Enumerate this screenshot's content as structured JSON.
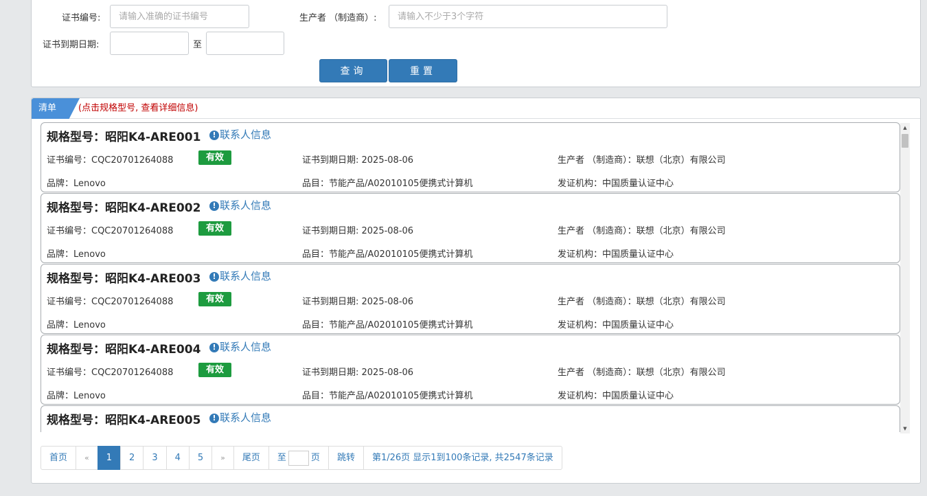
{
  "search": {
    "cert_no_label": "证书编号:",
    "cert_no_placeholder": "请输入准确的证书编号",
    "producer_label": "生产者 （制造商）:",
    "producer_placeholder": "请输入不少于3个字符",
    "expiry_label": "证书到期日期:",
    "range_sep": "至",
    "query_button": "查询",
    "reset_button": "重置"
  },
  "list": {
    "tab_label": "清单",
    "hint": "(点击规格型号, 查看详细信息)",
    "contact_label": "联系人信息",
    "records": [
      {
        "model": "规格型号：昭阳K4-ARE001",
        "cert_no": "证书编号：CQC20701264088",
        "status": "有效",
        "expiry": "证书到期日期: 2025-08-06",
        "producer": "生产者 （制造商）：联想（北京）有限公司",
        "brand": "品牌：Lenovo",
        "category": "品目：节能产品/A02010105便携式计算机",
        "issuer": "发证机构：中国质量认证中心"
      },
      {
        "model": "规格型号：昭阳K4-ARE002",
        "cert_no": "证书编号：CQC20701264088",
        "status": "有效",
        "expiry": "证书到期日期: 2025-08-06",
        "producer": "生产者 （制造商）：联想（北京）有限公司",
        "brand": "品牌：Lenovo",
        "category": "品目：节能产品/A02010105便携式计算机",
        "issuer": "发证机构：中国质量认证中心"
      },
      {
        "model": "规格型号：昭阳K4-ARE003",
        "cert_no": "证书编号：CQC20701264088",
        "status": "有效",
        "expiry": "证书到期日期: 2025-08-06",
        "producer": "生产者 （制造商）：联想（北京）有限公司",
        "brand": "品牌：Lenovo",
        "category": "品目：节能产品/A02010105便携式计算机",
        "issuer": "发证机构：中国质量认证中心"
      },
      {
        "model": "规格型号：昭阳K4-ARE004",
        "cert_no": "证书编号：CQC20701264088",
        "status": "有效",
        "expiry": "证书到期日期: 2025-08-06",
        "producer": "生产者 （制造商）：联想（北京）有限公司",
        "brand": "品牌：Lenovo",
        "category": "品目：节能产品/A02010105便携式计算机",
        "issuer": "发证机构：中国质量认证中心"
      },
      {
        "model": "规格型号：昭阳K4-ARE005"
      }
    ]
  },
  "pagination": {
    "first": "首页",
    "prev": "«",
    "pages": [
      "1",
      "2",
      "3",
      "4",
      "5"
    ],
    "current_page": "1",
    "next": "»",
    "last": "尾页",
    "goto_prefix": "至",
    "goto_suffix": "页",
    "jump": "跳转",
    "summary": "第1/26页  显示1到100条记录, 共2547条记录"
  },
  "colors": {
    "primary": "#337ab7",
    "tab": "#4a90d9",
    "hint": "#c00000",
    "valid_badge": "#1d9b3f"
  }
}
